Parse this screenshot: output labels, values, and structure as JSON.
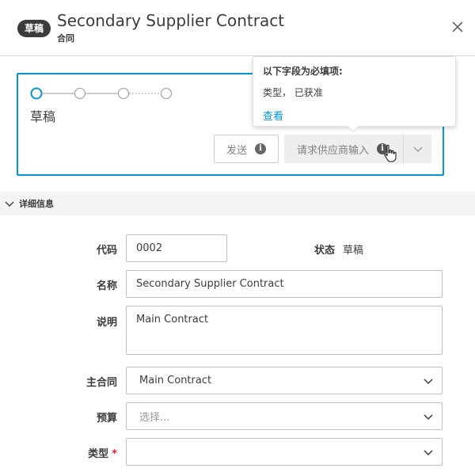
{
  "header": {
    "badge": "草稿",
    "title": "Secondary Supplier Contract",
    "subtitle": "合同"
  },
  "status": {
    "step_label": "草稿",
    "send_label": "发送",
    "request_label": "请求供应商输入"
  },
  "tooltip": {
    "heading": "以下字段为必填项:",
    "body": "类型， 已获准",
    "link": "查看"
  },
  "section": {
    "title": "详细信息"
  },
  "form": {
    "code_label": "代码",
    "code_value": "0002",
    "status_label": "状态",
    "status_value": "草稿",
    "name_label": "名称",
    "name_value": "Secondary Supplier Contract",
    "desc_label": "说明",
    "desc_value": "Main Contract",
    "master_label": "主合同",
    "master_value": "Main Contract",
    "budget_label": "预算",
    "budget_placeholder": "选择...",
    "type_label": "类型",
    "type_required": "*",
    "type_value": ""
  },
  "colors": {
    "accent": "#0696d7",
    "required": "#dd2222",
    "badge_bg": "#3c3c3c"
  }
}
